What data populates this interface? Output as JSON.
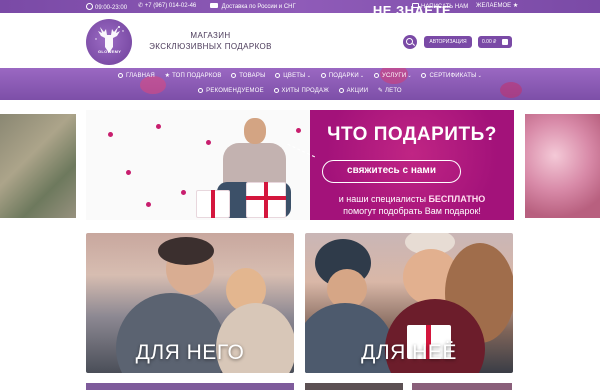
{
  "topbar": {
    "hours": "09:00-23:00",
    "phone": "+7 (967) 014-02-46",
    "delivery": "Доставка по России и СНГ",
    "write_us": "НАПИСАТЬ НАМ",
    "wishlist": "ЖЕЛАЕМОЕ"
  },
  "header": {
    "logo_text": "GLOWEMY",
    "store_line1": "МАГАЗИН",
    "store_line2": "ЭКСКЛЮЗИВНЫХ ПОДАРКОВ",
    "login_label": "АВТОРИЗАЦИЯ",
    "cart_label": "0.00 ₽"
  },
  "nav": {
    "row1": [
      {
        "label": "ГЛАВНАЯ",
        "dropdown": false
      },
      {
        "label": "ТОП ПОДАРКОВ",
        "dropdown": false
      },
      {
        "label": "ТОВАРЫ",
        "dropdown": false
      },
      {
        "label": "ЦВЕТЫ",
        "dropdown": true
      },
      {
        "label": "ПОДАРКИ",
        "dropdown": true
      },
      {
        "label": "УСЛУГИ",
        "dropdown": true
      },
      {
        "label": "СЕРТИФИКАТЫ",
        "dropdown": true
      }
    ],
    "row2": [
      {
        "label": "РЕКОМЕНДУЕМОЕ"
      },
      {
        "label": "ХИТЫ ПРОДАЖ"
      },
      {
        "label": "АКЦИИ"
      },
      {
        "label": "ЛЕТО"
      }
    ]
  },
  "banner": {
    "line1": "НЕ ЗНАЕТЕ",
    "line2": "ЧТО ПОДАРИТЬ?",
    "button": "свяжитесь с нами",
    "sub1_prefix": "и наши специалисты",
    "sub1_accent": "БЕСПЛАТНО",
    "sub2": "помогут подобрать Вам подарок!"
  },
  "tiles": {
    "him": "ДЛЯ НЕГО",
    "her": "ДЛЯ НЕЁ"
  },
  "colors": {
    "brand": "#7a4aa6",
    "banner_magenta": "#a3127a"
  }
}
